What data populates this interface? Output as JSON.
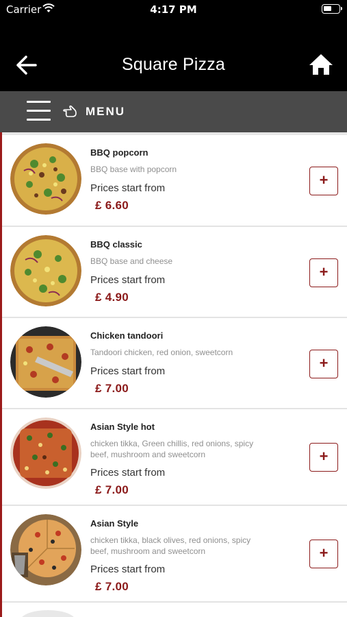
{
  "status_bar": {
    "carrier": "Carrier",
    "time": "4:17 PM",
    "wifi_icon": "wifi-icon",
    "battery_icon": "battery-icon"
  },
  "nav": {
    "title": "Square Pizza",
    "back_icon": "back-arrow-icon",
    "home_icon": "home-icon"
  },
  "menu_bar": {
    "label": "MENU",
    "hamburger_icon": "hamburger-icon",
    "hand_icon": "pointing-hand-icon"
  },
  "colors": {
    "accent": "#8b1a1a",
    "menu_bar_bg": "#4a4a4a",
    "header_bg": "#000000"
  },
  "items": [
    {
      "name": "BBQ popcorn",
      "desc": "BBQ base with popcorn",
      "prices_label": "Prices start from",
      "price": "£ 6.60",
      "add": "+"
    },
    {
      "name": "BBQ classic",
      "desc": "BBQ base and cheese",
      "prices_label": "Prices start from",
      "price": "£ 4.90",
      "add": "+"
    },
    {
      "name": "Chicken tandoori",
      "desc": "Tandoori chicken, red onion, sweetcorn",
      "prices_label": "Prices start from",
      "price": "£ 7.00",
      "add": "+"
    },
    {
      "name": "Asian Style hot",
      "desc": "chicken tikka, Green chillis, red onions, spicy beef, mushroom and sweetcorn",
      "prices_label": "Prices start from",
      "price": "£ 7.00",
      "add": "+"
    },
    {
      "name": "Asian Style",
      "desc": "chicken tikka, black olives, red onions, spicy beef, mushroom and sweetcorn",
      "prices_label": "Prices start from",
      "price": "£ 7.00",
      "add": "+"
    }
  ]
}
